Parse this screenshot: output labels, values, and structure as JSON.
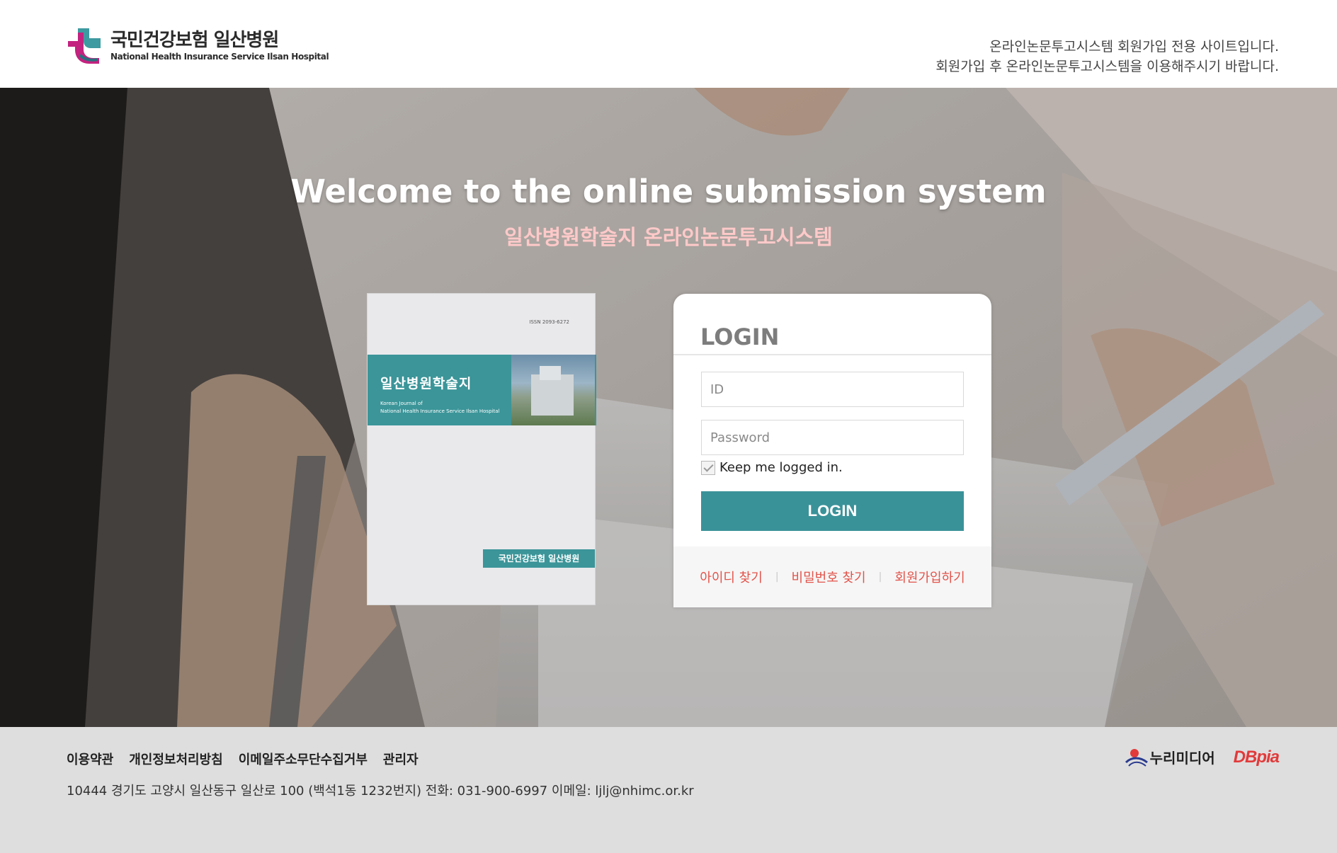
{
  "header": {
    "logo_ko": "국민건강보험 일산병원",
    "logo_en": "National  Health Insurance Service Ilsan Hospital",
    "notice_line1": "온라인논문투고시스템 회원가입 전용 사이트입니다.",
    "notice_line2": "회원가입 후 온라인논문투고시스템을 이용해주시기 바랍니다."
  },
  "hero": {
    "title": "Welcome to the online submission system",
    "subtitle": "일산병원학술지 온라인논문투고시스템"
  },
  "journal_cover": {
    "issn": "ISSN 2093-6272",
    "title": "일산병원학술지",
    "subtitle_line1": "Korean Journal of",
    "subtitle_line2": "National Health Insurance Service Ilsan Hospital",
    "publisher": "국민건강보험 일산병원"
  },
  "login": {
    "title": "LOGIN",
    "id_placeholder": "ID",
    "password_placeholder": "Password",
    "keep_logged_in": "Keep me logged in.",
    "keep_logged_in_checked": true,
    "button_label": "LOGIN",
    "find_id": "아이디 찾기",
    "find_password": "비밀번호 찾기",
    "register": "회원가입하기",
    "separator": "|"
  },
  "footer": {
    "nav": [
      "이용약관",
      "개인정보처리방침",
      "이메일주소무단수집거부",
      "관리자"
    ],
    "address": "10444 경기도 고양시 일산동구 일산로 100 (백석1동 1232번지) 전화: 031-900-6997 이메일: ljlj@nhimc.or.kr",
    "partner1": "누리미디어",
    "partner2": "DBpia"
  },
  "colors": {
    "accent_teal": "#3a9299",
    "link_red": "#e2534a",
    "subtitle_pink": "#ffc9c9"
  }
}
